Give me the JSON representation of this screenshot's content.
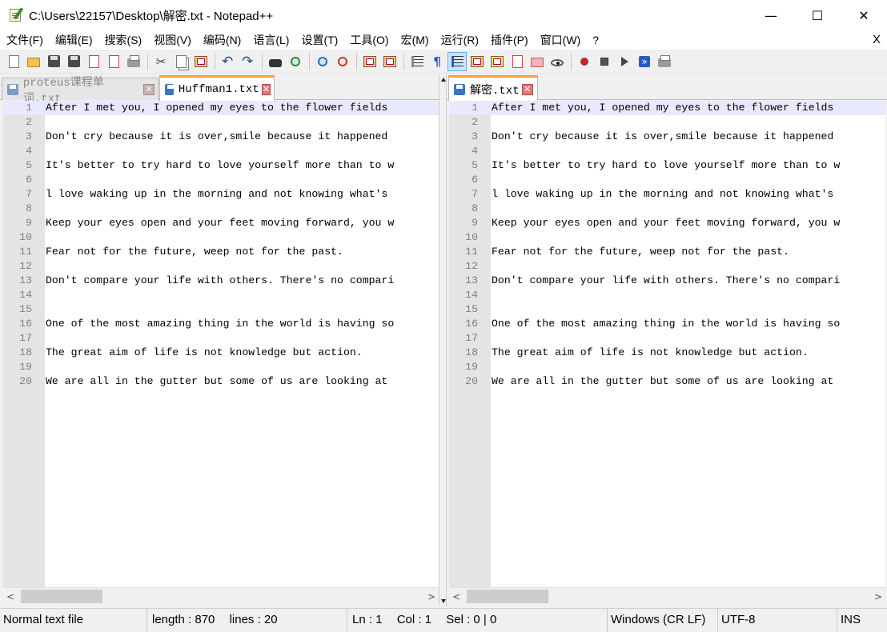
{
  "window": {
    "title": "C:\\Users\\22157\\Desktop\\解密.txt - Notepad++",
    "minimize_icon": "—",
    "maximize_icon": "☐",
    "close_icon": "✕"
  },
  "menu": {
    "items": [
      "文件(F)",
      "编辑(E)",
      "搜索(S)",
      "视图(V)",
      "编码(N)",
      "语言(L)",
      "设置(T)",
      "工具(O)",
      "宏(M)",
      "运行(R)",
      "插件(P)",
      "窗口(W)",
      "?"
    ],
    "close_label": "X"
  },
  "toolbar": {
    "icons": [
      "new-file-icon",
      "open-file-icon",
      "save-icon",
      "save-all-icon",
      "close-icon",
      "close-all-icon",
      "print-icon",
      "cut-icon",
      "copy-icon",
      "paste-icon",
      "undo-icon",
      "redo-icon",
      "find-icon",
      "replace-icon",
      "zoom-in-icon",
      "zoom-out-icon",
      "sync-vertical-icon",
      "sync-horizontal-icon",
      "word-wrap-icon",
      "show-all-characters-icon",
      "indent-guide-icon",
      "user-defined-language-icon",
      "document-map-icon",
      "function-list-icon",
      "folder-as-workspace-icon",
      "monitoring-icon",
      "record-macro-icon",
      "stop-recording-icon",
      "playback-macro-icon",
      "run-macro-multiple-icon",
      "save-macro-icon"
    ],
    "pilcrow": "¶"
  },
  "left_pane": {
    "tabs": [
      {
        "label": "proteus课程单词.txt",
        "active": false
      },
      {
        "label": "Huffman1.txt",
        "active": true
      }
    ],
    "close_glyph": "✕"
  },
  "right_pane": {
    "tabs": [
      {
        "label": "解密.txt",
        "active": true
      }
    ],
    "close_glyph": "✕"
  },
  "editor": {
    "lines": [
      "After I met you, I opened my eyes to the flower fields",
      "",
      "Don't cry because it is over,smile because it happened",
      "",
      "It's better to try hard to love yourself more than to w",
      "",
      "l love waking up in the morning and not knowing what's",
      "",
      "Keep your eyes open and your feet moving forward, you w",
      "",
      "Fear not for the future, weep not for the past.",
      "",
      "Don't compare your life with others. There's no compari",
      "",
      "",
      "One of the most amazing thing in the world is having so",
      "",
      "The great aim of life is not knowledge but action.",
      "",
      "We are all in the gutter but some of us are looking at"
    ],
    "current_line": 1
  },
  "scrollbar": {
    "left_arrow": "<",
    "right_arrow": ">"
  },
  "status": {
    "file_type": "Normal text file",
    "length": "length : 870",
    "lines": "lines : 20",
    "ln": "Ln : 1",
    "col": "Col : 1",
    "sel": "Sel : 0 | 0",
    "eol": "Windows (CR LF)",
    "encoding": "UTF-8",
    "mode": "INS"
  }
}
